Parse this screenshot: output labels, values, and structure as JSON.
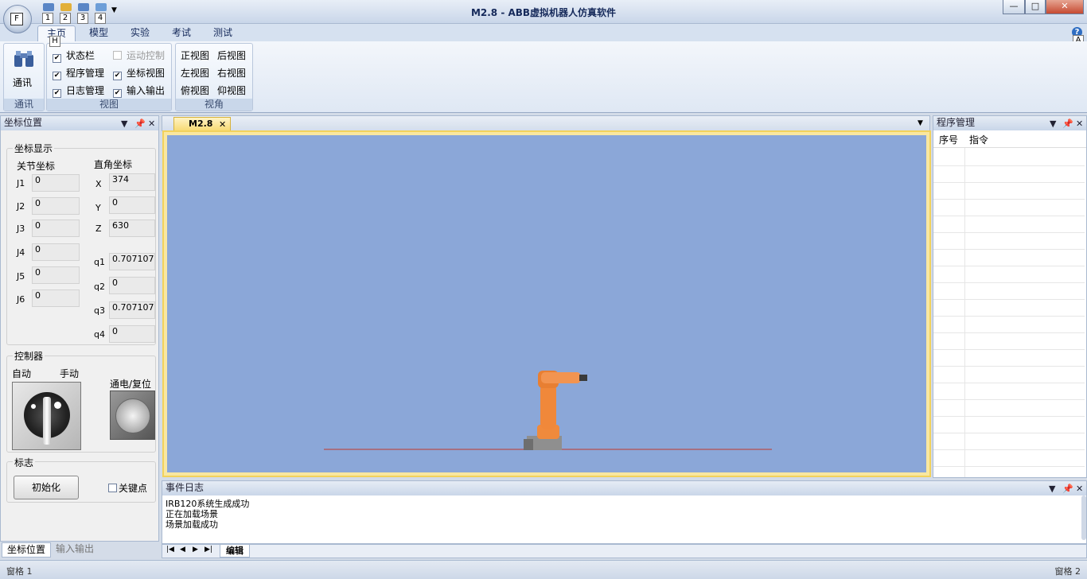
{
  "window": {
    "title": "M2.8 - ABB虚拟机器人仿真软件",
    "app_key": "F",
    "qat_keys": [
      "1",
      "2",
      "3",
      "4"
    ],
    "controls": {
      "minimize": "—",
      "maximize": "□",
      "close": "✕"
    }
  },
  "tabs": {
    "items": [
      {
        "label": "主页",
        "key": "H"
      },
      {
        "label": "模型"
      },
      {
        "label": "实验"
      },
      {
        "label": "考试"
      },
      {
        "label": "测试"
      }
    ],
    "help_key": "A"
  },
  "ribbon": {
    "comm": {
      "button": "通讯",
      "group": "通讯"
    },
    "view": {
      "group": "视图",
      "checks": [
        {
          "label": "状态栏",
          "checked": true
        },
        {
          "label": "运动控制",
          "checked": false,
          "disabled": true
        },
        {
          "label": "程序管理",
          "checked": true
        },
        {
          "label": "坐标视图",
          "checked": true
        },
        {
          "label": "日志管理",
          "checked": true
        },
        {
          "label": "输入输出",
          "checked": true
        }
      ]
    },
    "angle": {
      "group": "视角",
      "buttons": [
        "正视图",
        "后视图",
        "左视图",
        "右视图",
        "俯视图",
        "仰视图"
      ]
    }
  },
  "coord_panel": {
    "title": "坐标位置",
    "display_group": "坐标显示",
    "joint_header": "关节坐标",
    "cart_header": "直角坐标",
    "joints": [
      {
        "label": "J1",
        "value": "0"
      },
      {
        "label": "J2",
        "value": "0"
      },
      {
        "label": "J3",
        "value": "0"
      },
      {
        "label": "J4",
        "value": "0"
      },
      {
        "label": "J5",
        "value": "0"
      },
      {
        "label": "J6",
        "value": "0"
      }
    ],
    "cart": [
      {
        "label": "X",
        "value": "374"
      },
      {
        "label": "Y",
        "value": "0"
      },
      {
        "label": "Z",
        "value": "630"
      },
      {
        "label": "q1",
        "value": "0.707107"
      },
      {
        "label": "q2",
        "value": "0"
      },
      {
        "label": "q3",
        "value": "0.707107"
      },
      {
        "label": "q4",
        "value": "0"
      }
    ],
    "controller_group": "控制器",
    "auto_label": "自动",
    "manual_label": "手动",
    "power_label": "通电/复位",
    "flag_group": "标志",
    "init_button": "初始化",
    "keypoint_label": "关键点",
    "bottom_tabs": [
      "坐标位置",
      "输入输出"
    ]
  },
  "viewport": {
    "tab": "M2.8",
    "close": "✕",
    "dropdown": "▼"
  },
  "program_panel": {
    "title": "程序管理",
    "columns": [
      "序号",
      "指令"
    ]
  },
  "event_log": {
    "title": "事件日志",
    "lines": [
      "IRB120系统生成成功",
      "正在加载场景",
      "场景加载成功"
    ],
    "tab": "编辑"
  },
  "statusbar": {
    "left": "窗格 1",
    "right": "窗格 2"
  },
  "colors": {
    "scene": "#8ba7d8",
    "robot": "#f08a3c",
    "floor_line": "#c0392b"
  }
}
